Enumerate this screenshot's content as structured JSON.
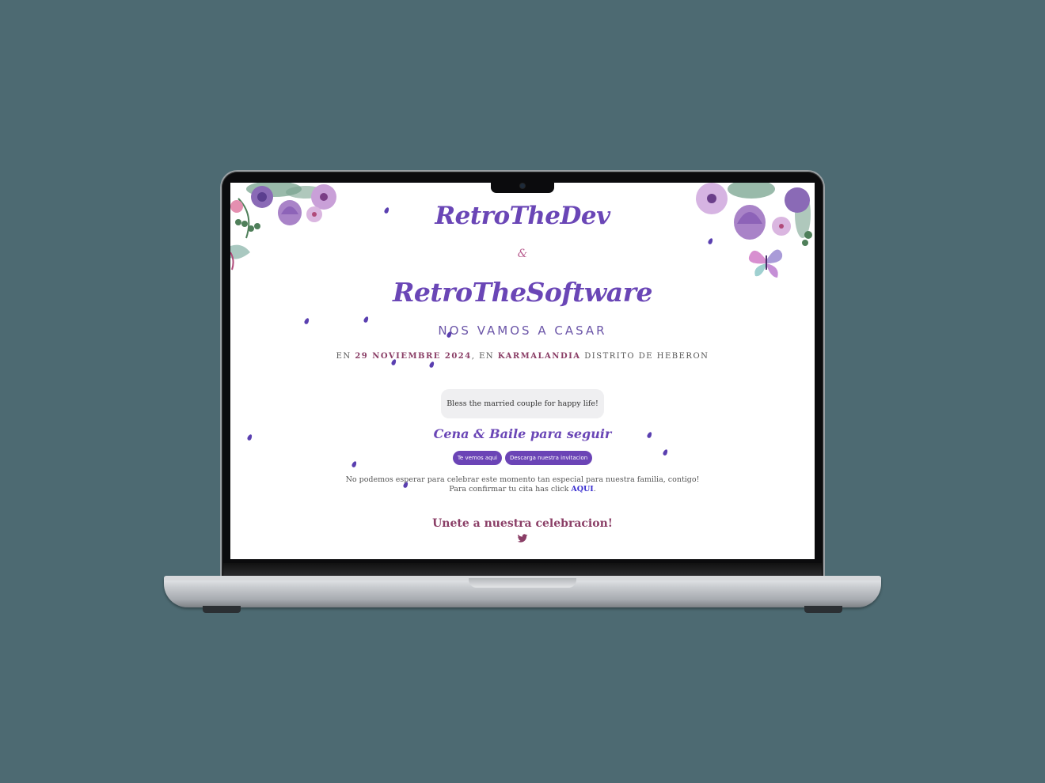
{
  "invitation": {
    "name_one": "RetroTheDev",
    "ampersand": "&",
    "name_two": "RetroTheSoftware",
    "headline": "NOS VAMOS A CASAR",
    "detail_prefix": "EN",
    "date": "29 NOVIEMBRE 2024",
    "detail_middle": ", EN",
    "place": "KARMALANDIA",
    "detail_suffix": "DISTRITO DE HEBERON",
    "bless_message": "Bless the married couple for happy life!",
    "event_title": "Cena & Baile para seguir",
    "buttons": {
      "location": "Te vemos aqui",
      "download": "Descarga nuestra invitacion"
    },
    "message_line1": "No podemos esperar para celebrar este momento tan especial para nuestra familia, contigo!",
    "message_line2": "Para confirmar tu cita has click",
    "confirm_link": "AQUI",
    "join_title": "Unete a nuestra celebracion!"
  },
  "icons": {
    "social": "twitter-icon",
    "decor_left": "flowers-top-left",
    "decor_right": "flowers-top-right",
    "butterfly": "butterfly-icon"
  },
  "colors": {
    "background": "#4d6a72",
    "accent_purple": "#6a46b6",
    "accent_plum": "#8a3e66",
    "link": "#3a2fd0"
  }
}
